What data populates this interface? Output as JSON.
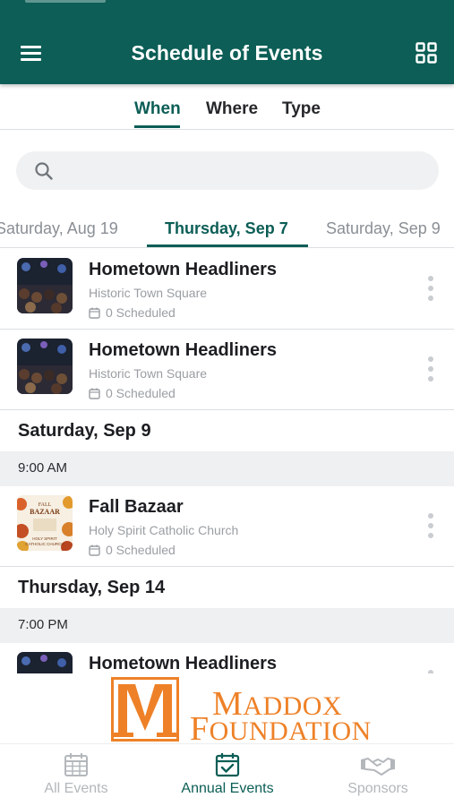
{
  "app_bar": {
    "title": "Schedule of Events",
    "menu_icon": "hamburger-menu-icon",
    "layout_icon": "grid-view-icon"
  },
  "filter_tabs": [
    {
      "label": "When",
      "active": true
    },
    {
      "label": "Where",
      "active": false
    },
    {
      "label": "Type",
      "active": false
    }
  ],
  "search": {
    "placeholder": "",
    "icon": "search-icon"
  },
  "date_tabs": [
    {
      "label": "Saturday, Aug 19",
      "active": false
    },
    {
      "label": "Thursday, Sep 7",
      "active": true
    },
    {
      "label": "Saturday, Sep 9",
      "active": false
    }
  ],
  "events_top": [
    {
      "title": "Hometown Headliners",
      "venue": "Historic Town Square",
      "scheduled": "0 Scheduled"
    },
    {
      "title": "Hometown Headliners",
      "venue": "Historic Town Square",
      "scheduled": "0 Scheduled"
    }
  ],
  "day_sections": [
    {
      "day": "Saturday, Sep 9",
      "time": "9:00 AM",
      "event": {
        "title": "Fall Bazaar",
        "venue": "Holy Spirit Catholic Church",
        "scheduled": "0 Scheduled",
        "poster_text": [
          "FALL",
          "BAZAAR",
          "HOLY SPIRIT",
          "CATHOLIC CHURCH"
        ]
      }
    },
    {
      "day": "Thursday, Sep 14",
      "time": "7:00 PM",
      "event": {
        "title": "Hometown Headliners"
      }
    }
  ],
  "sponsor_banner": {
    "logo_letter": "M",
    "line1_cap": "M",
    "line1_rest": "ADDOX",
    "line2_cap": "F",
    "line2_rest": "OUNDATION",
    "color": "#ee8128"
  },
  "bottom_nav": [
    {
      "label": "All Events",
      "icon": "calendar-grid-icon",
      "active": false
    },
    {
      "label": "Annual Events",
      "icon": "calendar-check-icon",
      "active": true
    },
    {
      "label": "Sponsors",
      "icon": "handshake-icon",
      "active": false
    }
  ],
  "colors": {
    "primary": "#0c5e56",
    "muted_text": "#9a9ea3",
    "section_bg": "#eef0f1",
    "sponsor_orange": "#ee8128"
  }
}
